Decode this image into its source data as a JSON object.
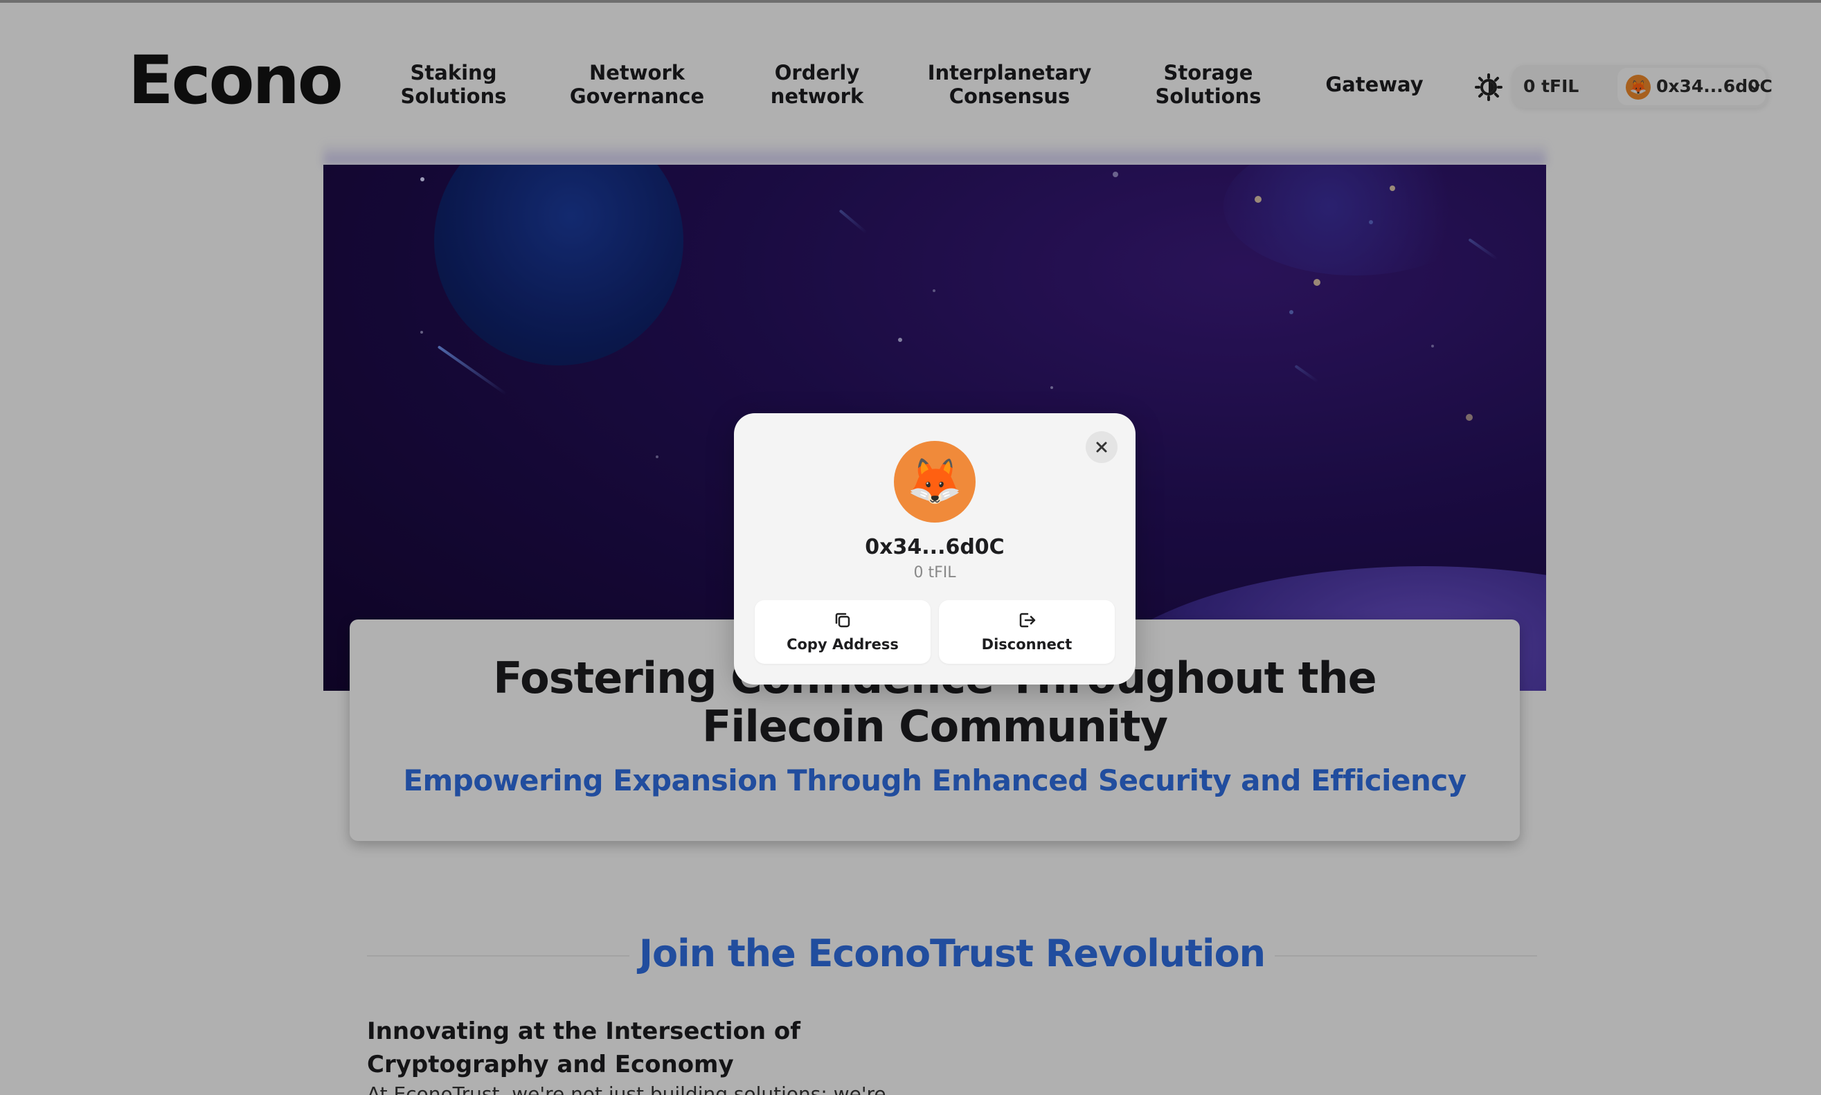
{
  "brand": {
    "logo": "Econo"
  },
  "nav": {
    "items": [
      {
        "line1": "Staking",
        "line2": "Solutions"
      },
      {
        "line1": "Network",
        "line2": "Governance"
      },
      {
        "line1": "Orderly",
        "line2": "network"
      },
      {
        "line1": "Interplanetary",
        "line2": "Consensus"
      },
      {
        "line1": "Storage",
        "line2": "Solutions"
      },
      {
        "line1": "Gateway",
        "line2": ""
      }
    ]
  },
  "wallet": {
    "balance": "0 tFIL",
    "address_short": "0x34...6d0C",
    "avatar_emoji": "🦊",
    "avatar_color": "#f08a3a"
  },
  "hero": {
    "title_line1": "Fostering Confidence Throughout the",
    "title_line2": "Filecoin Community",
    "subtitle": "Empowering Expansion Through Enhanced Security and Efficiency"
  },
  "section": {
    "title": "Join the EconoTrust Revolution",
    "heading_line1": "Innovating at the Intersection of",
    "heading_line2": "Cryptography and Economy",
    "text": "At EconoTrust, we're not just building solutions; we're"
  },
  "modal": {
    "avatar_emoji": "🦊",
    "address": "0x34...6d0C",
    "balance": "0 tFIL",
    "copy_label": "Copy Address",
    "disconnect_label": "Disconnect"
  },
  "colors": {
    "accent_blue": "#2f6bdc",
    "overlay": "rgba(0,0,0,0.28)",
    "hero_bg": "#1a0a45"
  }
}
